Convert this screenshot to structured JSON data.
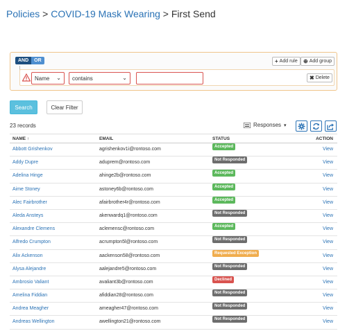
{
  "breadcrumb": {
    "items": [
      "Policies",
      "COVID-19 Mask Wearing"
    ],
    "separator": ">",
    "current": "First Send"
  },
  "filter": {
    "and_label": "AND",
    "or_label": "OR",
    "add_rule_label": "Add rule",
    "add_group_label": "Add group",
    "delete_label": "Delete",
    "field_value": "Name",
    "operator_value": "contains",
    "text_value": ""
  },
  "actions": {
    "search_label": "Search",
    "clear_label": "Clear Filter"
  },
  "toolbar": {
    "records_label": "23 records",
    "responses_label": "Responses"
  },
  "table": {
    "headers": {
      "name": "NAME",
      "sort_indicator": "↑",
      "email": "EMAIL",
      "status": "STATUS",
      "action": "ACTION"
    },
    "rows": [
      {
        "name": "Abbott Grishenkov",
        "email": "agrishenkov1i@rontoso.com",
        "status": "Accepted",
        "action": "View"
      },
      {
        "name": "Addy Dupre",
        "email": "aduprem@rontoso.com",
        "status": "Not Responded",
        "action": "View"
      },
      {
        "name": "Adelina Hinge",
        "email": "ahinge2b@rontoso.com",
        "status": "Accepted",
        "action": "View"
      },
      {
        "name": "Aime Stoney",
        "email": "astoney6b@rontoso.com",
        "status": "Accepted",
        "action": "View"
      },
      {
        "name": "Alec Fairbrother",
        "email": "afairbrother4r@rontoso.com",
        "status": "Accepted",
        "action": "View"
      },
      {
        "name": "Aleda Ansteys",
        "email": "akenwardq1@rontoso.com",
        "status": "Not Responded",
        "action": "View"
      },
      {
        "name": "Alexandre Clemens",
        "email": "aclemensc@rontoso.com",
        "status": "Accepted",
        "action": "View"
      },
      {
        "name": "Alfredo Crumpton",
        "email": "acrumpton5l@rontoso.com",
        "status": "Not Responded",
        "action": "View"
      },
      {
        "name": "Alix Ackenson",
        "email": "aackenson58@rontoso.com",
        "status": "Requested Exception",
        "action": "View"
      },
      {
        "name": "Alysa Alejandre",
        "email": "aalejandre5@rontoso.com",
        "status": "Not Responded",
        "action": "View"
      },
      {
        "name": "Ambrosio Valiant",
        "email": "avaliant3b@rontoso.com",
        "status": "Declined",
        "action": "View"
      },
      {
        "name": "Amelina Fiddian",
        "email": "afiddian28@rontoso.com",
        "status": "Not Responded",
        "action": "View"
      },
      {
        "name": "Andrea Meagher",
        "email": "ameagher47@rontoso.com",
        "status": "Not Responded",
        "action": "View"
      },
      {
        "name": "Andreas Wellington",
        "email": "awellington21@rontoso.com",
        "status": "Not Responded",
        "action": "View"
      }
    ]
  },
  "status_colors": {
    "Accepted": "#5cb85c",
    "Not Responded": "#6d6d6d",
    "Requested Exception": "#f0ad4e",
    "Declined": "#d9534f"
  },
  "icons": {
    "warning": "warning-icon",
    "add_rule": "plus-icon",
    "add_group": "plus-circle-icon",
    "delete": "close-icon",
    "responses": "list-icon",
    "settings": "gear-icon",
    "refresh": "refresh-icon",
    "export": "export-icon"
  }
}
